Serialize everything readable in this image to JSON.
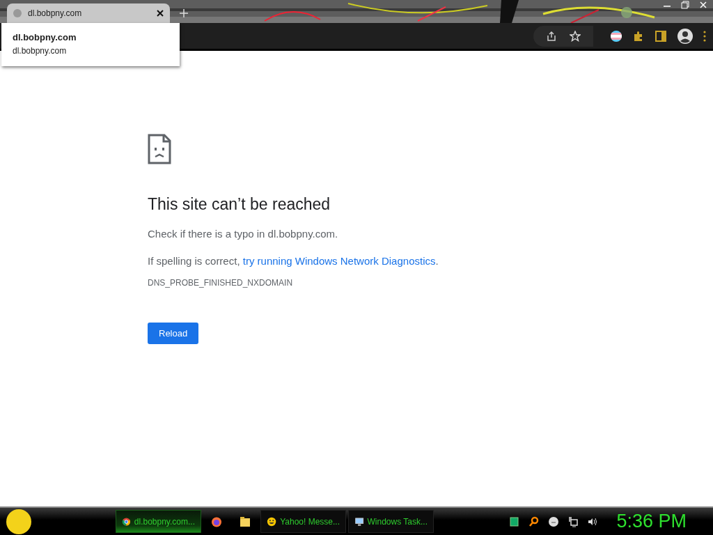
{
  "tab": {
    "title": "dl.bobpny.com",
    "selected": true
  },
  "tooltip": {
    "title": "dl.bobpny.com",
    "url": "dl.bobpny.com"
  },
  "error": {
    "title": "This site can’t be reached",
    "hint": "Check if there is a typo in dl.bobpny.com.",
    "suggestion_prefix": "If spelling is correct, ",
    "suggestion_link": "try running Windows Network Diagnostics",
    "suggestion_suffix": ".",
    "code": "DNS_PROBE_FINISHED_NXDOMAIN",
    "button": "Reload"
  },
  "taskbar": {
    "items": [
      {
        "kind": "browser",
        "label": "dl.bobpny.com...",
        "selected": true
      },
      {
        "kind": "firefox",
        "selected": false
      },
      {
        "kind": "folder",
        "selected": false
      },
      {
        "kind": "messenger",
        "label": "Yahoo! Messe...",
        "selected": false
      },
      {
        "kind": "taskmgr",
        "label": "Windows Task...",
        "selected": false
      }
    ],
    "clock": "5:36 PM"
  }
}
